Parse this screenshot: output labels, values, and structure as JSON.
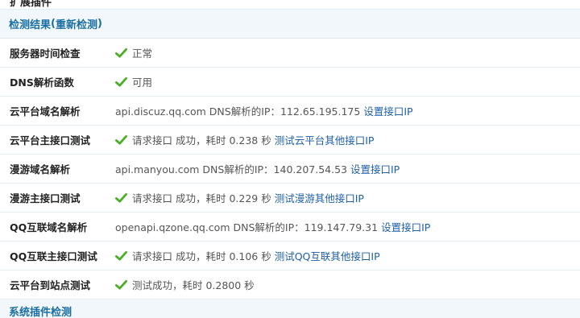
{
  "top_cut_text": "扩展插件",
  "section1": {
    "title": "检测结果",
    "relink_open": "(",
    "relink": "重新检测",
    "relink_close": ")"
  },
  "rows": [
    {
      "label": "服务器时间检查",
      "check": true,
      "text": "正常",
      "link": ""
    },
    {
      "label": "DNS解析函数",
      "check": true,
      "text": "可用",
      "link": ""
    },
    {
      "label": "云平台域名解析",
      "check": false,
      "text": "api.discuz.qq.com DNS解析的IP：112.65.195.175",
      "link": "设置接口IP"
    },
    {
      "label": "云平台主接口测试",
      "check": true,
      "text": "请求接口 成功，耗时 0.238 秒",
      "link": "测试云平台其他接口IP"
    },
    {
      "label": "漫游域名解析",
      "check": false,
      "text": "api.manyou.com DNS解析的IP：140.207.54.53",
      "link": "设置接口IP"
    },
    {
      "label": "漫游主接口测试",
      "check": true,
      "text": "请求接口 成功，耗时 0.229 秒",
      "link": "测试漫游其他接口IP"
    },
    {
      "label": "QQ互联域名解析",
      "check": false,
      "text": "openapi.qzone.qq.com DNS解析的IP：119.147.79.31",
      "link": "设置接口IP"
    },
    {
      "label": "QQ互联主接口测试",
      "check": true,
      "text": "请求接口 成功，耗时 0.106 秒",
      "link": "测试QQ互联其他接口IP"
    },
    {
      "label": "云平台到站点测试",
      "check": true,
      "text": "测试成功，耗时 0.2800 秒",
      "link": ""
    }
  ],
  "section2": {
    "title": "系统插件检测"
  },
  "colors": {
    "header_bg": "#f2f7fb",
    "header_text": "#1a6fa0",
    "link": "#1f5fa6",
    "check": "#4caf2a"
  },
  "icons": {
    "check": "check-icon"
  }
}
